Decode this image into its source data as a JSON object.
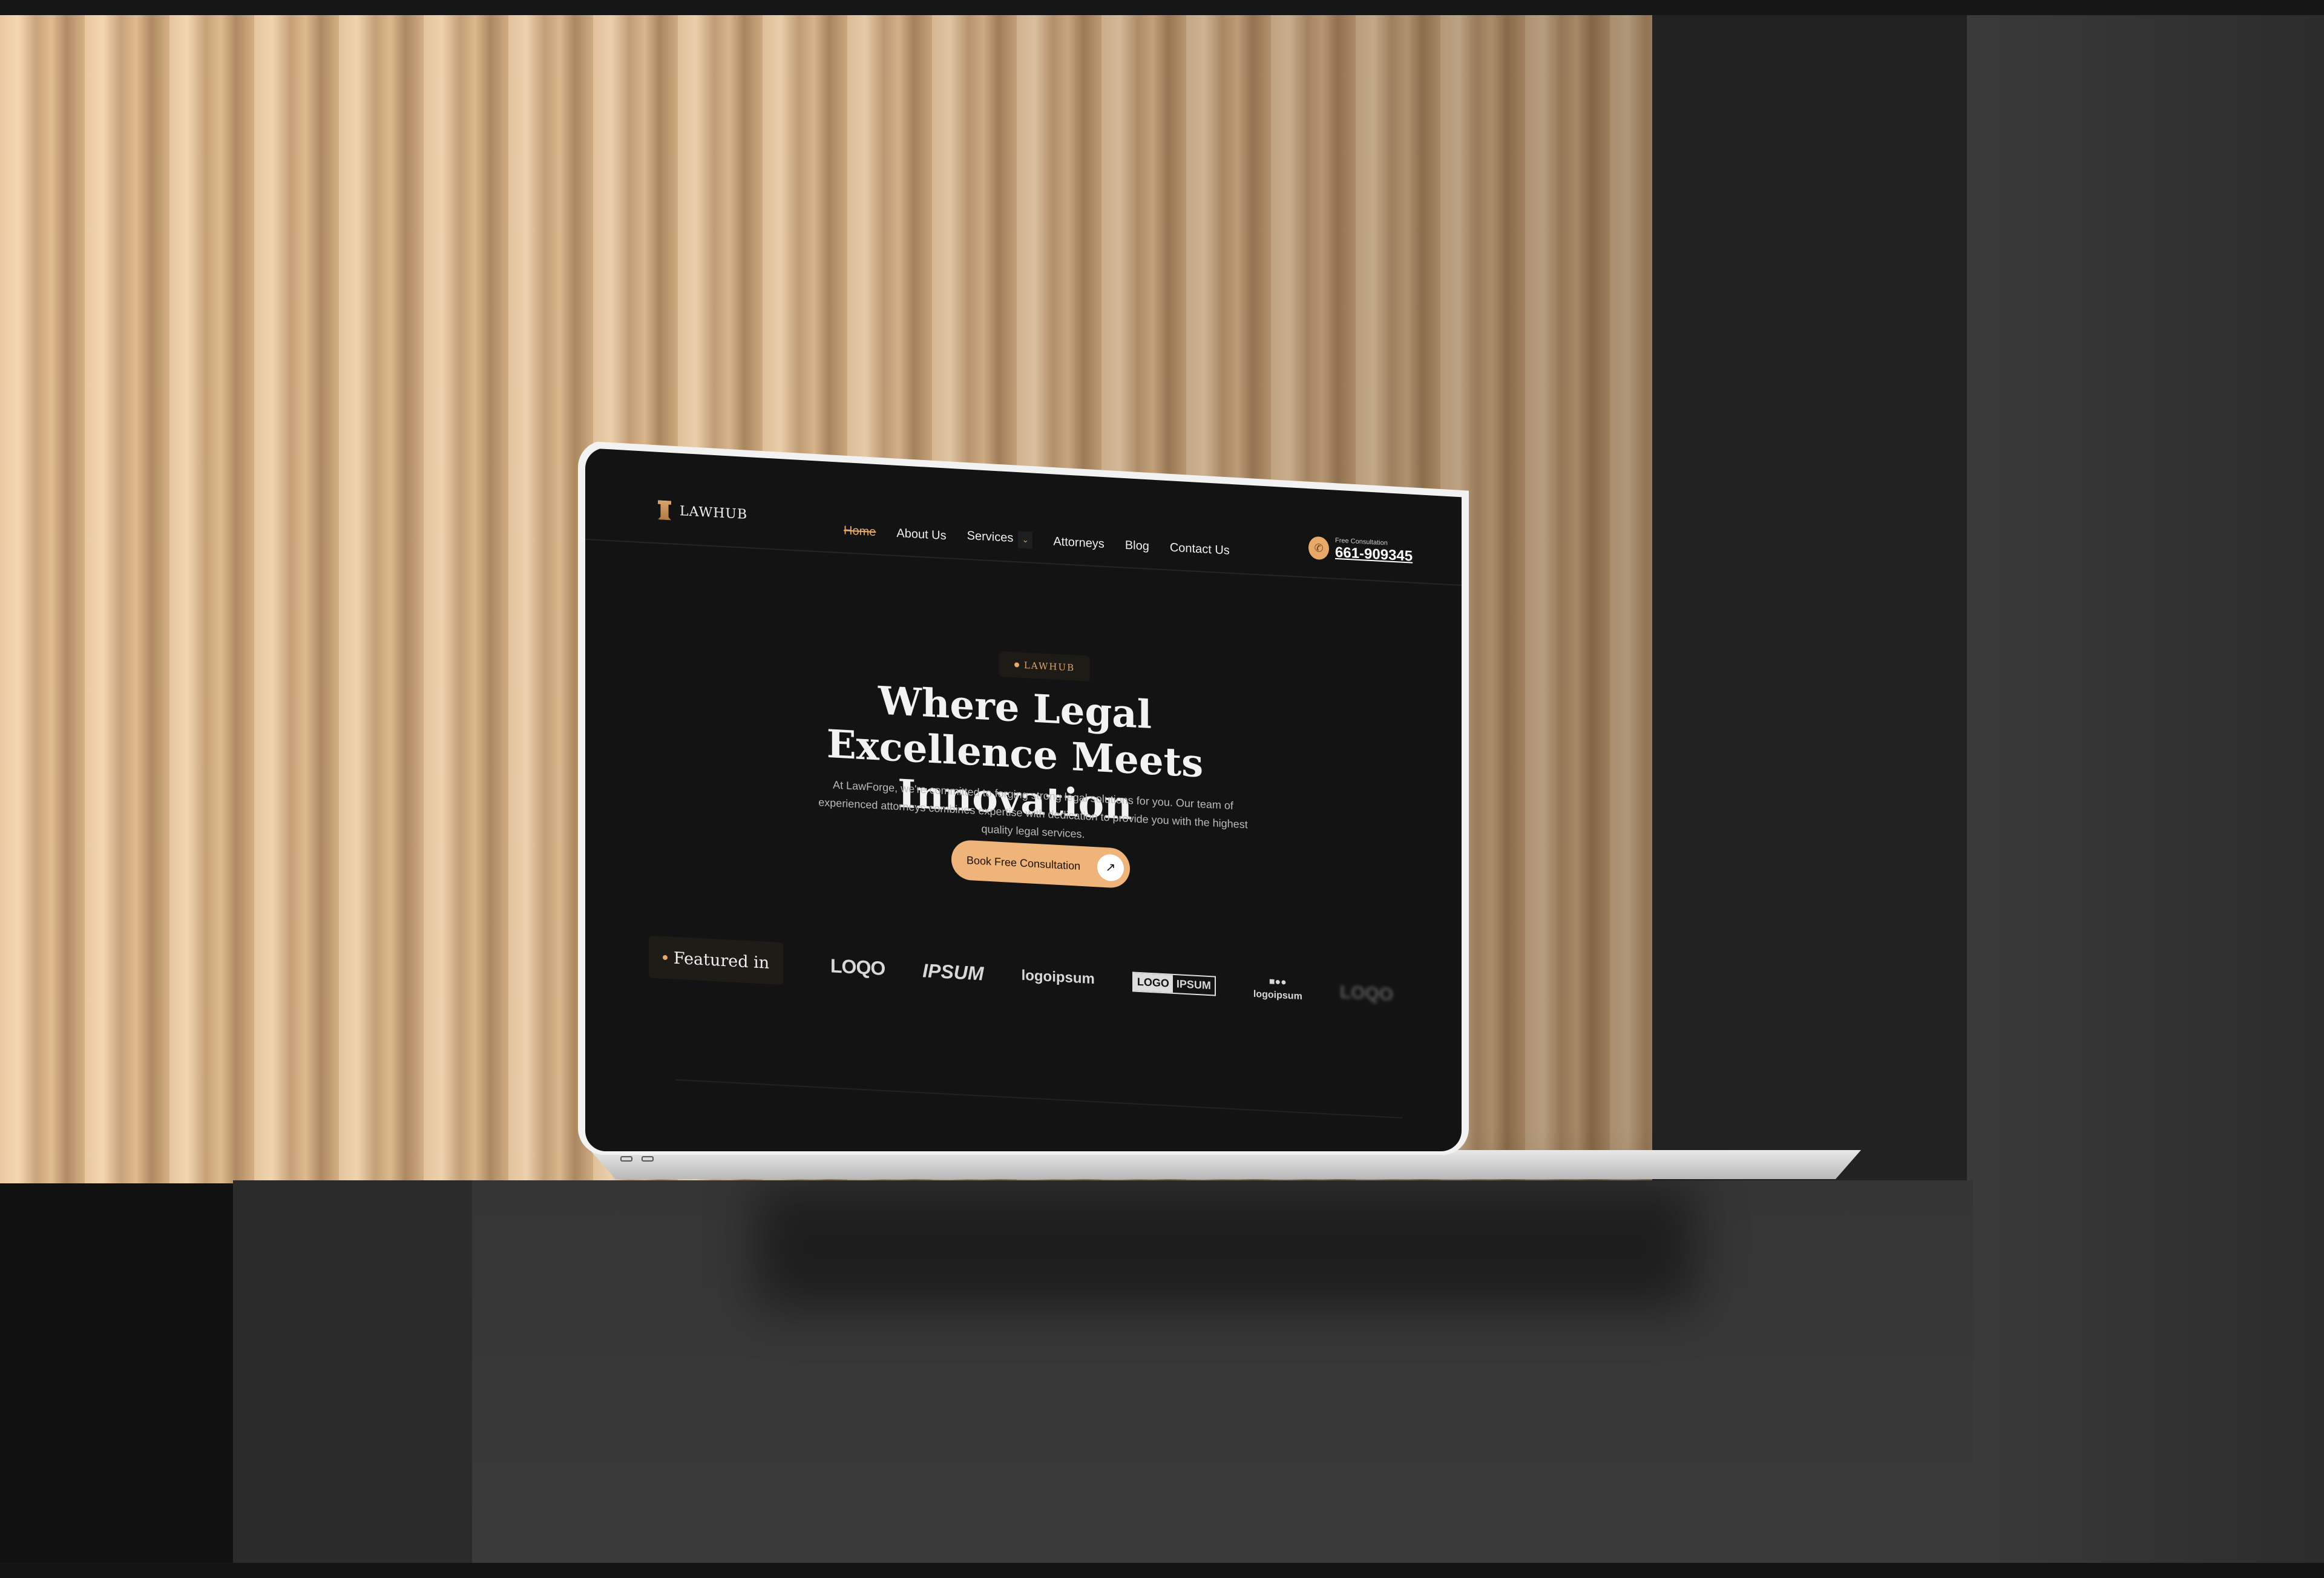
{
  "site": {
    "logo_text": "LAWHUB",
    "nav": [
      {
        "label": "Home",
        "active": true
      },
      {
        "label": "About Us"
      },
      {
        "label": "Services",
        "has_dropdown": true
      },
      {
        "label": "Attorneys"
      },
      {
        "label": "Blog"
      },
      {
        "label": "Contact Us"
      }
    ],
    "phone": {
      "label": "Free Consultation",
      "number": "661-909345",
      "icon": "phone-icon"
    },
    "hero": {
      "badge": "LAWHUB",
      "title": "Where Legal Excellence Meets Innovation",
      "description": "At LawForge, we're committed to forging strong legal solutions for you. Our team of experienced attorneys combines expertise with dedication to provide you with the highest quality legal services.",
      "cta": "Book Free Consultation"
    },
    "featured": {
      "label": "Featured in",
      "logos": [
        "LOQO",
        "IPSUM",
        "logoipsum",
        "LOGO",
        "IPSUM",
        "logoipsum",
        "LOQO"
      ]
    }
  },
  "colors": {
    "accent": "#e8a869",
    "background": "#131313"
  }
}
